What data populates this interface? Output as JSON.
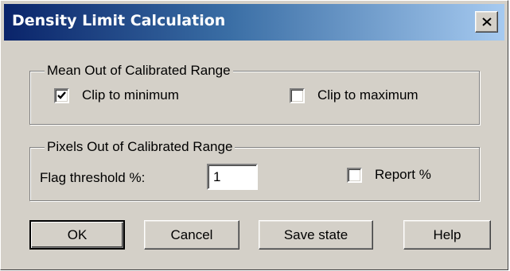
{
  "window": {
    "title": "Density Limit Calculation",
    "close_icon": "close-x-icon"
  },
  "mean_group": {
    "legend": "Mean Out of Calibrated Range",
    "clip_min": {
      "label": "Clip to minimum",
      "checked": true
    },
    "clip_max": {
      "label": "Clip to maximum",
      "checked": false
    }
  },
  "pixels_group": {
    "legend": "Pixels Out of Calibrated Range",
    "flag_threshold_label": "Flag threshold %:",
    "flag_threshold_value": "1",
    "report": {
      "label": "Report %",
      "checked": false
    }
  },
  "buttons": {
    "ok": "OK",
    "cancel": "Cancel",
    "save_state": "Save state",
    "help": "Help"
  }
}
